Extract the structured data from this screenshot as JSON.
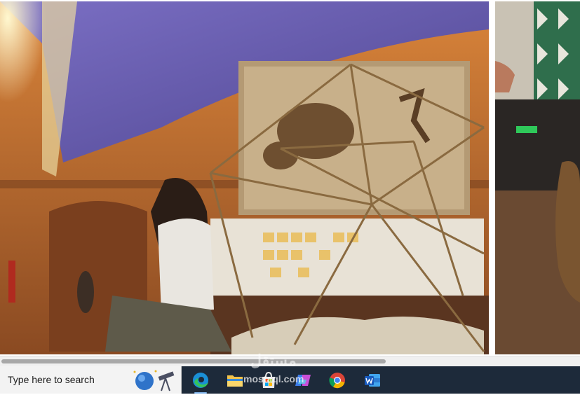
{
  "viewer": {
    "main_photo": "photo",
    "side_photo": "photo"
  },
  "taskbar": {
    "search": {
      "placeholder": "Type here to search"
    },
    "apps": [
      {
        "name": "Microsoft Edge",
        "icon": "edge-icon"
      },
      {
        "name": "File Explorer",
        "icon": "folder-icon"
      },
      {
        "name": "Microsoft Store",
        "icon": "store-icon"
      },
      {
        "name": "Copilot",
        "icon": "copilot-icon"
      },
      {
        "name": "Google Chrome",
        "icon": "chrome-icon"
      },
      {
        "name": "Microsoft Word",
        "icon": "word-icon"
      }
    ]
  },
  "watermark": {
    "arabic": "مستقل",
    "latin": "mostaql.com"
  },
  "colors": {
    "taskbar_bg": "#1d2a3a",
    "search_bg": "#f3f3f3",
    "ceiling_purple": "#6a5fb0",
    "wall_orange": "#cf7a35",
    "scroll_thumb": "#a8a8a8"
  }
}
